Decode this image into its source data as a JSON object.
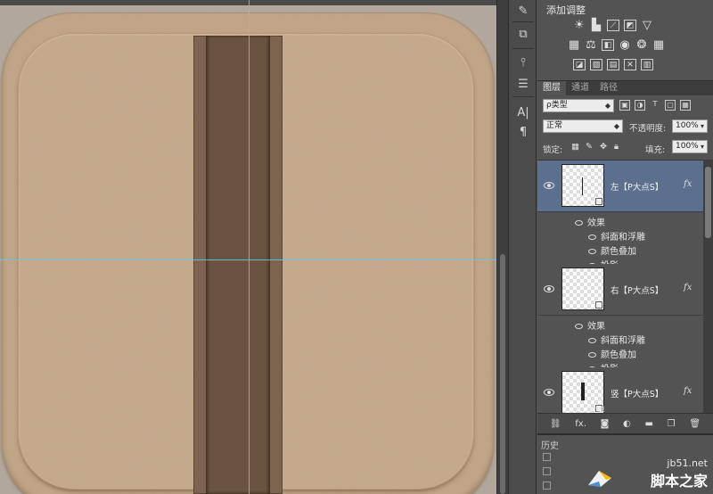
{
  "adjustments": {
    "title": "添加调整",
    "row1": [
      "sun-icon",
      "levels-icon",
      "curves-icon",
      "exposure-icon",
      "triangle-icon"
    ],
    "row2": [
      "hue-icon",
      "balance-icon",
      "bw-icon",
      "camera-icon",
      "mixer-icon",
      "lookup-icon"
    ],
    "row3": [
      "invert-icon",
      "posterize-icon",
      "threshold-icon",
      "selective-icon",
      "gradient-map-icon"
    ]
  },
  "layers": {
    "tabs": [
      "图层",
      "通道",
      "路径"
    ],
    "active_tab": "图层",
    "filter_label": "ρ类型",
    "blend_mode": "正常",
    "opacity_label": "不透明度:",
    "opacity_value": "100%",
    "lock_label": "锁定:",
    "fill_label": "填充:",
    "fill_value": "100%",
    "items": [
      {
        "name": "左【P大点S】",
        "selected": true,
        "fx": "fx",
        "effects_label": "效果",
        "effects": [
          "斜面和浮雕",
          "颜色叠加",
          "投影"
        ]
      },
      {
        "name": "右【P大点S】",
        "selected": false,
        "fx": "fx",
        "effects_label": "效果",
        "effects": [
          "斜面和浮雕",
          "颜色叠加",
          "投影"
        ]
      },
      {
        "name": "竖【P大点S】",
        "selected": false,
        "fx": "fx",
        "effects_label": "效果",
        "effects": []
      }
    ],
    "footer_icons": [
      "link-icon",
      "fx-icon",
      "mask-icon",
      "adjustment-icon",
      "folder-icon",
      "new-layer-icon",
      "trash-icon"
    ],
    "footer_fx": "fx."
  },
  "history": {
    "tab_label": "历史"
  },
  "watermark": {
    "url": "jb51.net",
    "name": "脚本之家"
  },
  "colors": {
    "canvas_bg": "#b1a79c",
    "icon_outer": "#c4a88a",
    "icon_inner": "#c9ae91",
    "bar_frame": "#7c6450",
    "bar_core": "#6a5440",
    "guide": "#5ec9f0",
    "layer_selected": "#5c6f8f",
    "panel_bg": "#535353"
  }
}
